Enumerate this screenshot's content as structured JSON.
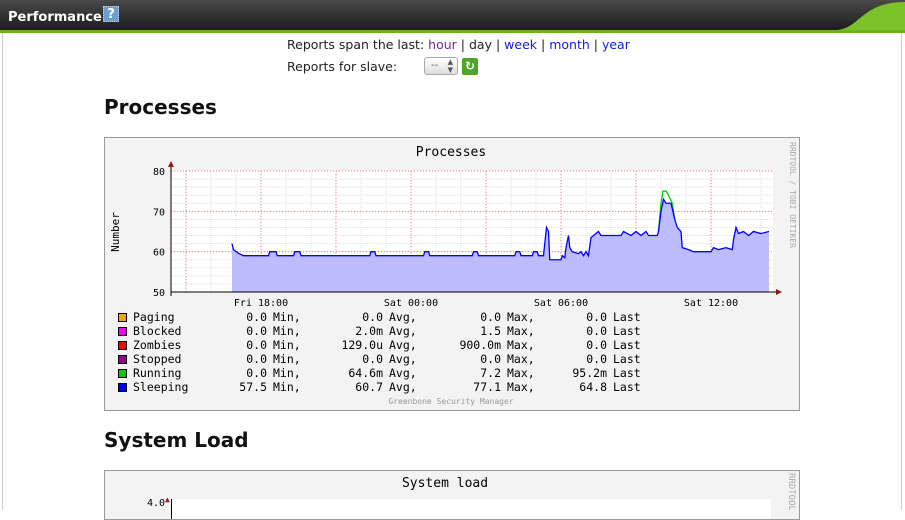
{
  "header": {
    "title": "Performance",
    "help_icon": "?"
  },
  "controls": {
    "span_label": "Reports span the last:",
    "links": [
      "hour",
      "day",
      "week",
      "month",
      "year"
    ],
    "separator": "|",
    "slave_label": "Reports for slave:",
    "slave_value": "--"
  },
  "sections": {
    "processes": "Processes",
    "system_load": "System Load"
  },
  "chart_data": [
    {
      "type": "area",
      "title": "Processes",
      "ylabel": "Number",
      "ylim": [
        50,
        80
      ],
      "yticks": [
        "50",
        "60",
        "70",
        "80"
      ],
      "xticks": [
        {
          "label": "Fri 18:00",
          "h": 18
        },
        {
          "label": "Sat 00:00",
          "h": 24
        },
        {
          "label": "Sat 06:00",
          "h": 30
        },
        {
          "label": "Sat 12:00",
          "h": 36
        }
      ],
      "xlim_hours": [
        14.4,
        38.5
      ],
      "watermark": "RRDTOOL / TOBI OETIKER",
      "footer": "Greenbone Security Manager",
      "legend": [
        {
          "name": "Paging",
          "color": "#f5a500",
          "min": "0.0",
          "avg": "0.0",
          "max": "0.0",
          "last": "0.0"
        },
        {
          "name": "Blocked",
          "color": "#ff00ff",
          "min": "0.0",
          "avg": "2.0m",
          "max": "1.5",
          "last": "0.0"
        },
        {
          "name": "Zombies",
          "color": "#ff0000",
          "min": "0.0",
          "avg": "129.0u",
          "max": "900.0m",
          "last": "0.0"
        },
        {
          "name": "Stopped",
          "color": "#990099",
          "min": "0.0",
          "avg": "0.0",
          "max": "0.0",
          "last": "0.0"
        },
        {
          "name": "Running",
          "color": "#00cc00",
          "min": "0.0",
          "avg": "64.6m",
          "max": "7.2",
          "last": "95.2m"
        },
        {
          "name": "Sleeping",
          "color": "#0000ff",
          "min": "57.5",
          "avg": "60.7",
          "max": "77.1",
          "last": "64.8"
        }
      ],
      "labels": {
        "min": "Min,",
        "avg": "Avg,",
        "max": "Max,",
        "last": "Last"
      },
      "sleeping": [
        [
          16.84,
          62
        ],
        [
          16.9,
          60.5
        ],
        [
          17.1,
          59.6
        ],
        [
          17.3,
          59
        ],
        [
          18.3,
          59
        ],
        [
          18.35,
          60
        ],
        [
          18.6,
          60
        ],
        [
          18.65,
          59
        ],
        [
          19.3,
          59
        ],
        [
          19.35,
          60
        ],
        [
          19.55,
          60
        ],
        [
          19.6,
          59
        ],
        [
          22.35,
          59
        ],
        [
          22.4,
          60
        ],
        [
          22.55,
          60
        ],
        [
          22.6,
          59
        ],
        [
          24.5,
          59
        ],
        [
          24.55,
          60
        ],
        [
          24.7,
          60
        ],
        [
          24.75,
          59
        ],
        [
          26.45,
          59
        ],
        [
          26.5,
          60
        ],
        [
          26.65,
          60
        ],
        [
          26.7,
          59
        ],
        [
          28.15,
          59
        ],
        [
          28.2,
          60
        ],
        [
          28.35,
          60
        ],
        [
          28.4,
          59
        ],
        [
          28.85,
          59
        ],
        [
          28.9,
          60
        ],
        [
          29.05,
          60
        ],
        [
          29.1,
          59
        ],
        [
          29.3,
          59
        ],
        [
          29.35,
          62
        ],
        [
          29.42,
          66
        ],
        [
          29.5,
          65
        ],
        [
          29.55,
          58
        ],
        [
          30.0,
          58
        ],
        [
          30.05,
          59
        ],
        [
          30.15,
          58.5
        ],
        [
          30.2,
          61
        ],
        [
          30.3,
          64
        ],
        [
          30.35,
          61
        ],
        [
          30.45,
          60
        ],
        [
          30.7,
          59.5
        ],
        [
          30.8,
          60
        ],
        [
          30.9,
          59
        ],
        [
          31.0,
          60
        ],
        [
          31.1,
          59
        ],
        [
          31.2,
          63.5
        ],
        [
          31.3,
          64
        ],
        [
          31.5,
          65
        ],
        [
          31.6,
          64
        ],
        [
          32.4,
          64
        ],
        [
          32.5,
          65
        ],
        [
          32.8,
          64
        ],
        [
          33.0,
          65
        ],
        [
          33.2,
          64
        ],
        [
          33.4,
          65
        ],
        [
          33.5,
          64
        ],
        [
          33.85,
          64
        ],
        [
          33.9,
          65
        ],
        [
          34.0,
          70
        ],
        [
          34.1,
          73
        ],
        [
          34.2,
          72
        ],
        [
          34.4,
          72
        ],
        [
          34.55,
          68
        ],
        [
          34.65,
          66
        ],
        [
          34.8,
          65
        ],
        [
          34.85,
          61
        ],
        [
          35.1,
          60.5
        ],
        [
          35.3,
          60
        ],
        [
          36.0,
          60
        ],
        [
          36.1,
          61
        ],
        [
          36.3,
          60.5
        ],
        [
          36.6,
          61
        ],
        [
          36.85,
          60.5
        ],
        [
          36.9,
          63
        ],
        [
          37.0,
          66
        ],
        [
          37.1,
          64.5
        ],
        [
          37.3,
          65
        ],
        [
          37.5,
          64
        ],
        [
          37.7,
          65
        ],
        [
          38.0,
          64.5
        ],
        [
          38.32,
          65
        ]
      ],
      "running_peak": [
        [
          33.9,
          65
        ],
        [
          34.0,
          72
        ],
        [
          34.08,
          75
        ],
        [
          34.2,
          75
        ],
        [
          34.3,
          74
        ],
        [
          34.45,
          72
        ],
        [
          34.55,
          68
        ]
      ]
    },
    {
      "type": "line",
      "title": "System load",
      "yticks": [
        "4.0"
      ],
      "watermark": "RRDTOOL"
    }
  ]
}
